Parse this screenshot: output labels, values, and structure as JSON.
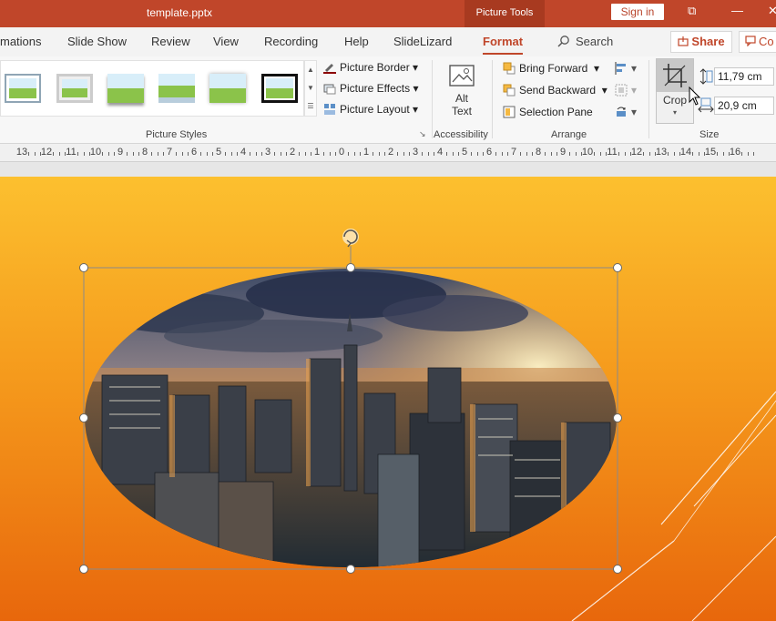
{
  "titlebar": {
    "document_title": "template.pptx",
    "context_tab": "Picture Tools",
    "signin_label": "Sign in",
    "restore_glyph": "⧉",
    "minimize_glyph": "—",
    "close_glyph": "✕"
  },
  "tabs": {
    "items": [
      {
        "label": "mations"
      },
      {
        "label": "Slide Show"
      },
      {
        "label": "Review"
      },
      {
        "label": "View"
      },
      {
        "label": "Recording"
      },
      {
        "label": "Help"
      },
      {
        "label": "SlideLizard"
      },
      {
        "label": "Format"
      }
    ],
    "search_label": "Search",
    "share_label": "Share",
    "comments_label": "Co"
  },
  "ribbon": {
    "picture_styles": {
      "label": "Picture Styles",
      "thumb_count": 6,
      "picture_border": "Picture Border",
      "picture_effects": "Picture Effects",
      "picture_layout": "Picture Layout"
    },
    "accessibility": {
      "label": "Accessibility",
      "alt_text_line1": "Alt",
      "alt_text_line2": "Text"
    },
    "arrange": {
      "label": "Arrange",
      "bring_forward": "Bring Forward",
      "send_backward": "Send Backward",
      "selection_pane": "Selection Pane"
    },
    "size": {
      "label": "Size",
      "crop_label": "Crop",
      "height_value": "11,79 cm",
      "width_value": "20,9 cm"
    }
  },
  "ruler": {
    "labels": [
      "13",
      "12",
      "11",
      "10",
      "9",
      "8",
      "7",
      "6",
      "5",
      "4",
      "3",
      "2",
      "1",
      "0",
      "1",
      "2",
      "3",
      "4",
      "5",
      "6",
      "7",
      "8",
      "9",
      "10",
      "11",
      "12",
      "13",
      "14",
      "15",
      "16"
    ]
  },
  "colors": {
    "accent": "#c0462a",
    "slide_top": "#fcc02f",
    "slide_bottom": "#e8670c"
  }
}
